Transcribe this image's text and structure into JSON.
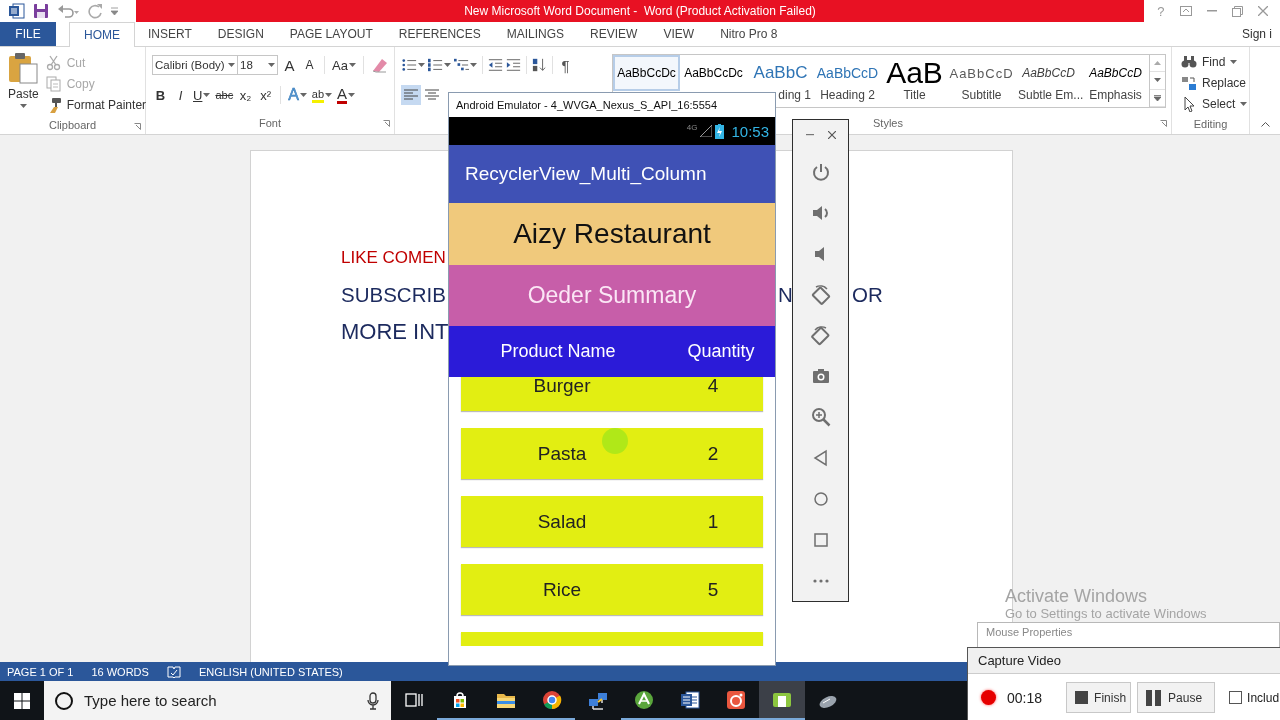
{
  "title_bar": {
    "title": "New Microsoft Word Document -  Word (Product Activation Failed)",
    "help": "?"
  },
  "ribbon_tabs": [
    {
      "label": "FILE",
      "kind": "file",
      "selected": false
    },
    {
      "label": "HOME",
      "kind": "tab",
      "selected": true
    },
    {
      "label": "INSERT",
      "kind": "tab",
      "selected": false
    },
    {
      "label": "DESIGN",
      "kind": "tab",
      "selected": false
    },
    {
      "label": "PAGE LAYOUT",
      "kind": "tab",
      "selected": false
    },
    {
      "label": "REFERENCES",
      "kind": "tab",
      "selected": false
    },
    {
      "label": "MAILINGS",
      "kind": "tab",
      "selected": false
    },
    {
      "label": "REVIEW",
      "kind": "tab",
      "selected": false
    },
    {
      "label": "VIEW",
      "kind": "tab",
      "selected": false
    },
    {
      "label": "Nitro Pro 8",
      "kind": "tab",
      "selected": false
    }
  ],
  "account": {
    "label": "Sign i"
  },
  "clipboard": {
    "paste": "Paste",
    "actions": [
      {
        "label": "Cut",
        "kind": "cut",
        "disabled": true
      },
      {
        "label": "Copy",
        "kind": "copy",
        "disabled": true
      },
      {
        "label": "Format Painter",
        "kind": "painter",
        "disabled": false
      }
    ],
    "label": "Clipboard"
  },
  "font": {
    "name": "Calibri (Body)",
    "size": "18",
    "grow": "A",
    "shrink": "A",
    "change_case": "Aa",
    "label": "Font",
    "format_buttons": [
      {
        "label": "B",
        "kind": "bold"
      },
      {
        "label": "I",
        "kind": "italic"
      },
      {
        "label": "U",
        "kind": "underline"
      },
      {
        "label": "abc",
        "kind": "strike"
      },
      {
        "label": "x₂",
        "kind": "sub"
      },
      {
        "label": "x²",
        "kind": "sup"
      },
      {
        "label": "A",
        "kind": "effects"
      },
      {
        "label": "ab",
        "kind": "highlight"
      },
      {
        "label": "A",
        "kind": "color"
      }
    ]
  },
  "paragraph": {
    "show_marks": "¶",
    "alignment": [
      {
        "kind": "left",
        "selected": true
      },
      {
        "kind": "center",
        "selected": false
      }
    ]
  },
  "styles": {
    "label": "Styles",
    "items": [
      {
        "preview": "AaBbCcDc",
        "kind": "normal",
        "selected": true
      },
      {
        "preview": "AaBbCcDc",
        "kind": "no_spacing",
        "selected": false
      },
      {
        "preview": "AaBbC",
        "name": "ding 1",
        "kind": "heading1",
        "selected": false
      },
      {
        "preview": "AaBbCcD",
        "name": "Heading 2",
        "kind": "heading2",
        "selected": false
      },
      {
        "preview": "AaB",
        "name": "Title",
        "kind": "title",
        "selected": false
      },
      {
        "preview": "AaBbCcD",
        "name": "Subtitle",
        "kind": "subtitle",
        "selected": false
      },
      {
        "preview": "AaBbCcD",
        "name": "Subtle Em...",
        "kind": "subtle_emphasis",
        "selected": false
      },
      {
        "preview": "AaBbCcD",
        "name": "Emphasis",
        "kind": "emphasis",
        "selected": false
      }
    ]
  },
  "editing": {
    "label": "Editing",
    "actions": [
      {
        "label": "Find",
        "kind": "find"
      },
      {
        "label": "Replace",
        "kind": "replace"
      },
      {
        "label": "Select",
        "kind": "select"
      }
    ]
  },
  "document": {
    "line_1": "LIKE COMEN",
    "line_2": [
      "SUBSCRIB",
      "N",
      "OR"
    ],
    "line_3": "MORE INT"
  },
  "status_bar": {
    "page": "PAGE 1 OF 1",
    "words": "16 WORDS",
    "language": "ENGLISH (UNITED STATES)"
  },
  "taskbar": {
    "search_placeholder": "Type here to search",
    "apps": [
      {
        "kind": "task_view",
        "running": false,
        "selected": false
      },
      {
        "kind": "store",
        "running": true,
        "selected": false
      },
      {
        "kind": "explorer",
        "running": true,
        "selected": false
      },
      {
        "kind": "browser",
        "running": true,
        "selected": false
      },
      {
        "kind": "network",
        "running": false,
        "selected": false
      },
      {
        "kind": "android",
        "running": true,
        "selected": false
      },
      {
        "kind": "word",
        "running": true,
        "selected": false
      },
      {
        "kind": "camera",
        "running": true,
        "selected": false
      },
      {
        "kind": "green_app",
        "running": true,
        "selected": true
      },
      {
        "kind": "mouse",
        "running": false,
        "selected": false
      }
    ]
  },
  "emulator": {
    "title": "Android Emulator - 4_WVGA_Nexus_S_API_16:5554",
    "network": "4G",
    "time": "10:53",
    "app_title": "RecyclerView_Multi_Column",
    "restaurant": "Aizy Restaurant",
    "section": "Oeder Summary",
    "columns": [
      "Product Name",
      "Quantity"
    ],
    "rows": [
      {
        "name": "Burger",
        "quantity": "4"
      },
      {
        "name": "Pasta",
        "quantity": "2"
      },
      {
        "name": "Salad",
        "quantity": "1"
      },
      {
        "name": "Rice",
        "quantity": "5"
      }
    ],
    "partial_row": true
  },
  "emulator_toolbar": {
    "buttons": [
      {
        "kind": "power"
      },
      {
        "kind": "volume_up"
      },
      {
        "kind": "volume_down"
      },
      {
        "kind": "rotate_left"
      },
      {
        "kind": "rotate_right"
      },
      {
        "kind": "camera"
      },
      {
        "kind": "zoom"
      },
      {
        "kind": "back"
      },
      {
        "kind": "home"
      },
      {
        "kind": "overview"
      },
      {
        "kind": "more"
      }
    ]
  },
  "mouse_properties": {
    "title": "Mouse Properties"
  },
  "activation_notice": {
    "title": "Activate Windows",
    "message": "Go to Settings to activate Windows"
  },
  "capture_video": {
    "title": "Capture Video",
    "recording": true,
    "elapsed": "00:18",
    "buttons": [
      {
        "label": "Finish",
        "kind": "stop"
      },
      {
        "label": "Pause",
        "kind": "pause"
      }
    ],
    "include_checkbox": {
      "label": "Includ",
      "checked": false
    }
  }
}
